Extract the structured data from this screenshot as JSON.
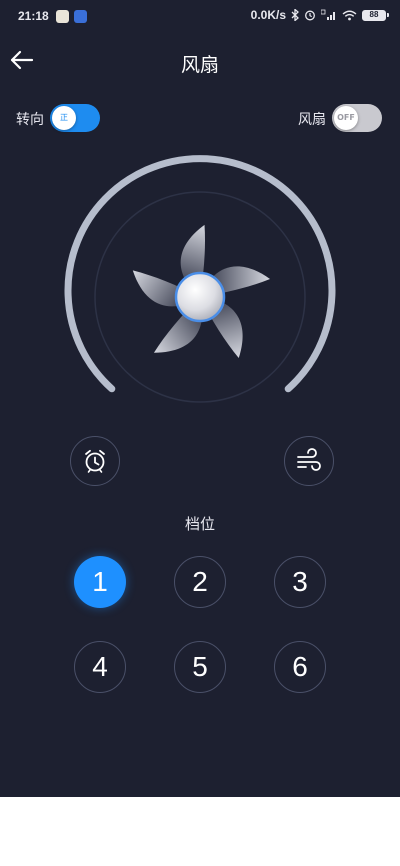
{
  "status_bar": {
    "time": "21:18",
    "network_speed": "0.0K/s",
    "battery_level": "88"
  },
  "header": {
    "title": "风扇",
    "back_icon": "arrow-left-icon"
  },
  "direction_toggle": {
    "label": "转向",
    "state_text": "正",
    "on": true
  },
  "fan_toggle": {
    "label": "风扇",
    "state_text": "OFF",
    "on": false
  },
  "controls": {
    "timer_icon": "alarm-clock-icon",
    "wind_mode_icon": "wind-icon"
  },
  "gear": {
    "title": "档位",
    "levels": [
      "1",
      "2",
      "3",
      "4",
      "5",
      "6"
    ],
    "selected": "1"
  },
  "colors": {
    "background": "#1d2030",
    "accent": "#1e8cf0",
    "arc": "#b6bdcc",
    "outline": "#4a5068"
  }
}
